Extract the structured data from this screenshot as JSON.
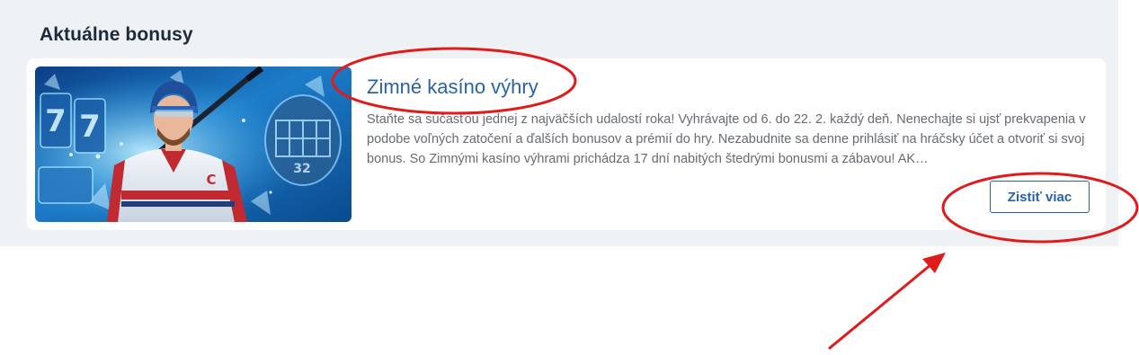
{
  "section": {
    "title": "Aktuálne bonusy"
  },
  "card": {
    "title": "Zimné kasíno výhry",
    "description": "Staňte sa súčasťou jednej z najväčších udalostí roka! Vyhrávajte od 6. do 22. 2. každý deň. Nenechajte si ujsť prekvapenia v podobe voľných zatočení a ďalších bonusov a prémií do hry. Nezabudnite sa denne prihlásiť na hráčsky účet a otvoriť si svoj bonus. So Zimnými kasíno výhrami prichádza 17 dní nabitých štedrými bonusmi a zábavou! AK…",
    "button_label": "Zistiť viac",
    "image": {
      "jersey_letter": "C",
      "helmet_number": "32"
    }
  },
  "colors": {
    "panel_bg": "#eef2f5",
    "accent": "#2a62a8",
    "annotation_red": "#e01b1b"
  }
}
